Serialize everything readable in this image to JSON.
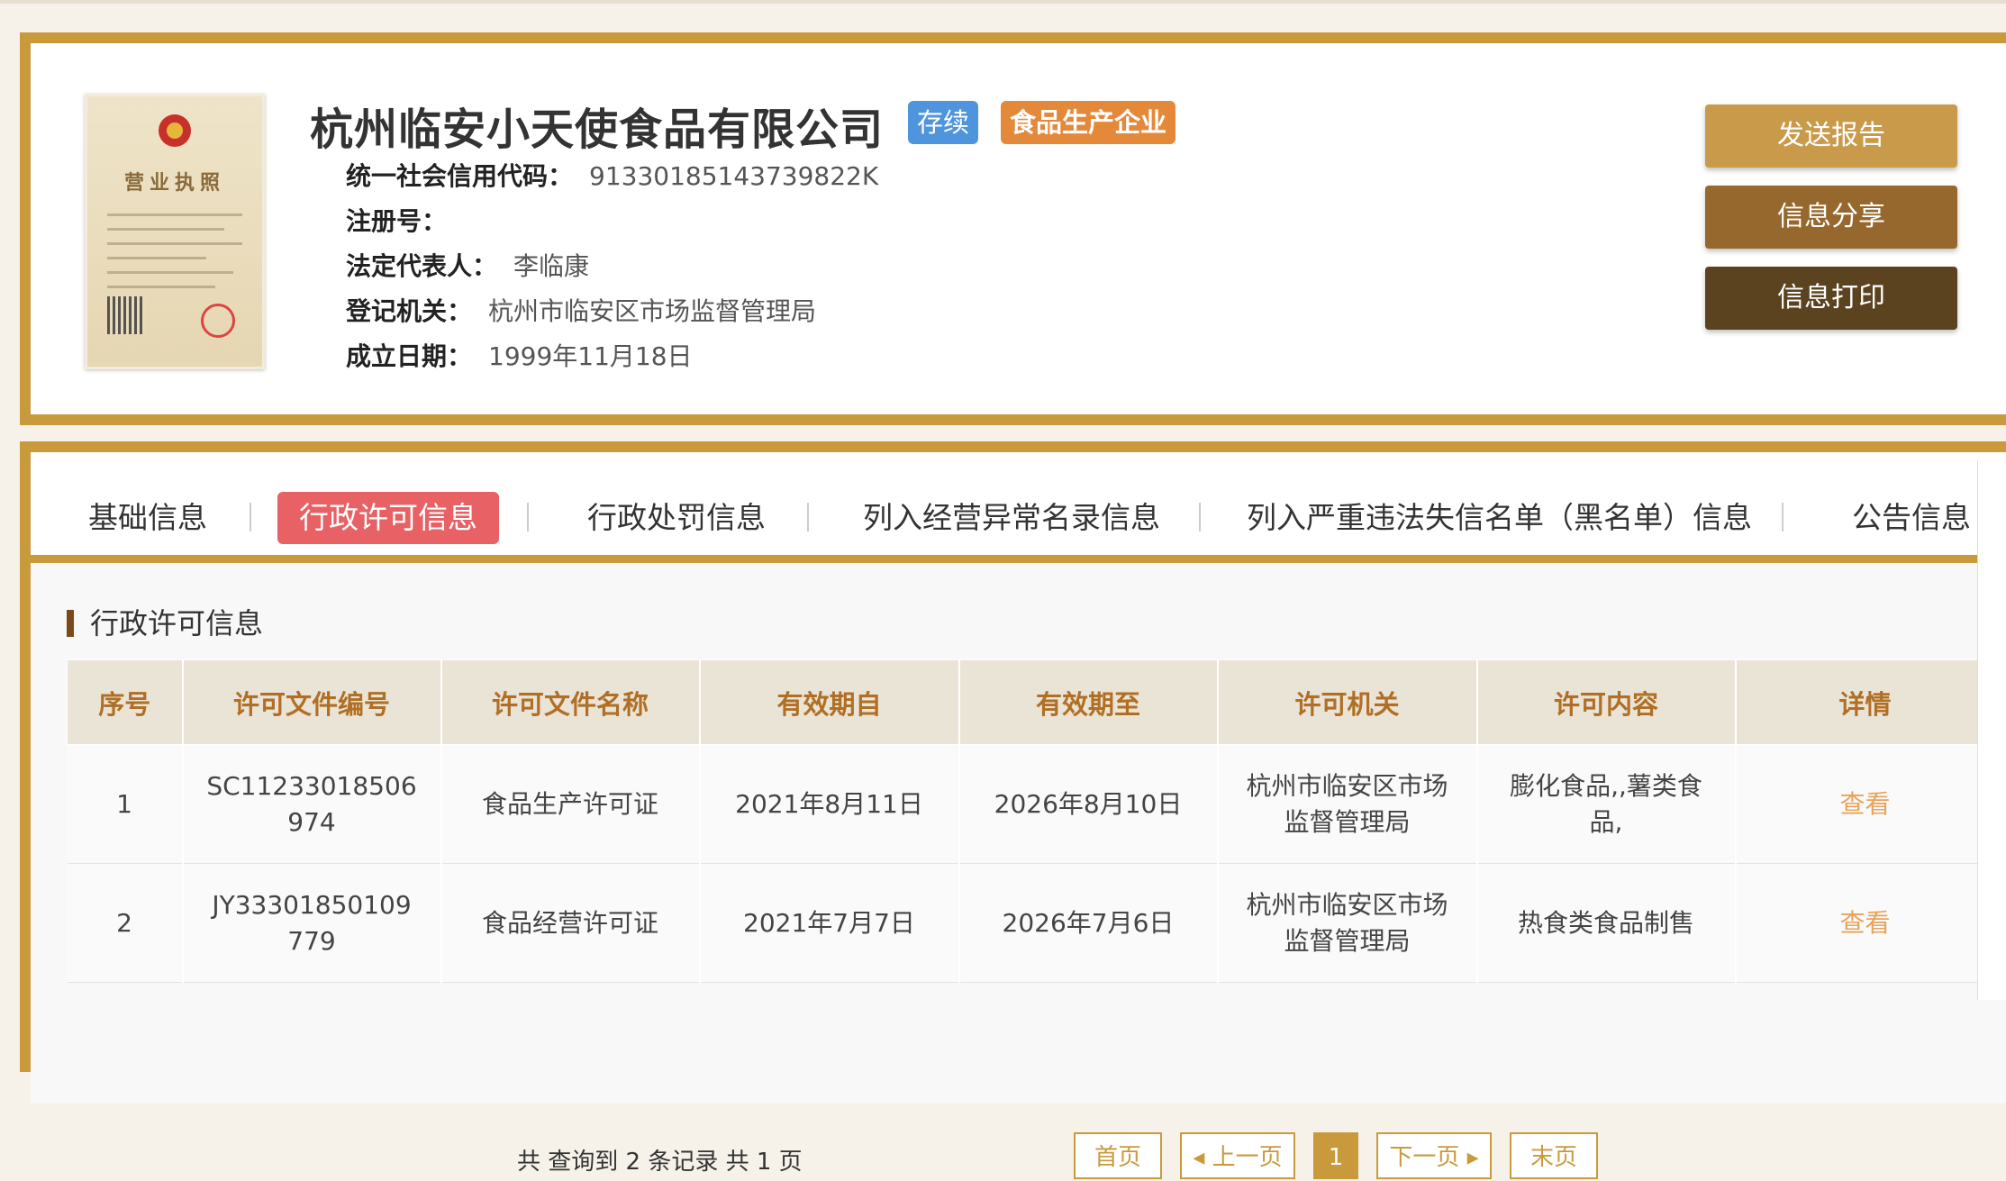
{
  "company": {
    "name": "杭州临安小天使食品有限公司",
    "status_tag": "存续",
    "type_tag": "食品生产企业",
    "license_image_title": "营业执照",
    "fields": [
      {
        "label": "统一社会信用代码：",
        "value": "91330185143739822K"
      },
      {
        "label": "注册号：",
        "value": ""
      },
      {
        "label": "法定代表人：",
        "value": "李临康"
      },
      {
        "label": "登记机关：",
        "value": "杭州市临安区市场监督管理局"
      },
      {
        "label": "成立日期：",
        "value": "1999年11月18日"
      }
    ]
  },
  "actions": {
    "send_report": "发送报告",
    "share": "信息分享",
    "print": "信息打印"
  },
  "tabs": [
    {
      "label": "基础信息"
    },
    {
      "label": "行政许可信息"
    },
    {
      "label": "行政处罚信息"
    },
    {
      "label": "列入经营异常名录信息"
    },
    {
      "label": "列入严重违法失信名单（黑名单）信息"
    },
    {
      "label": "公告信息"
    }
  ],
  "active_tab": "行政许可信息",
  "section": {
    "title": "行政许可信息",
    "columns": [
      "序号",
      "许可文件编号",
      "许可文件名称",
      "有效期自",
      "有效期至",
      "许可机关",
      "许可内容",
      "详情"
    ],
    "rows": [
      [
        "1",
        "SC11233018506974",
        "食品生产许可证",
        "2021年8月11日",
        "2026年8月10日",
        "杭州市临安区市场监督管理局",
        "膨化食品,,薯类食品,",
        "查看"
      ],
      [
        "2",
        "JY33301850109779",
        "食品经营许可证",
        "2021年7月7日",
        "2026年7月6日",
        "杭州市临安区市场监督管理局",
        "热食类食品制售",
        "查看"
      ]
    ]
  },
  "pagination": {
    "summary": "共 查询到 2 条记录 共 1 页",
    "first": "首页",
    "prev": "◂ 上一页",
    "current": "1",
    "next": "下一页 ▸",
    "last": "末页"
  },
  "colors": {
    "gold": "#c99a3c",
    "active_tab": "#e86165",
    "status_tag": "#4e95de",
    "type_tag": "#e4893a",
    "link": "#e8a35a"
  }
}
